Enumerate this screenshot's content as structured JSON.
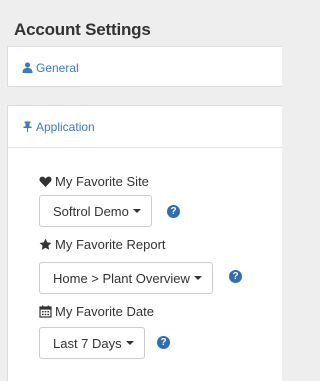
{
  "page": {
    "title": "Account Settings"
  },
  "accent_color": "#3a7cbf",
  "help_icon_color": "#2f6db5",
  "general": {
    "label": "General",
    "icon": "user-icon"
  },
  "application": {
    "label": "Application",
    "icon": "pushpin-icon",
    "favorite_site": {
      "label": "My Favorite Site",
      "icon": "heart-icon",
      "value": "Softrol Demo",
      "help": "?"
    },
    "favorite_report": {
      "label": "My Favorite Report",
      "icon": "star-icon",
      "value": "Home > Plant Overview",
      "help": "?"
    },
    "favorite_date": {
      "label": "My Favorite Date",
      "icon": "calendar-icon",
      "value": "Last 7 Days",
      "help": "?"
    }
  }
}
